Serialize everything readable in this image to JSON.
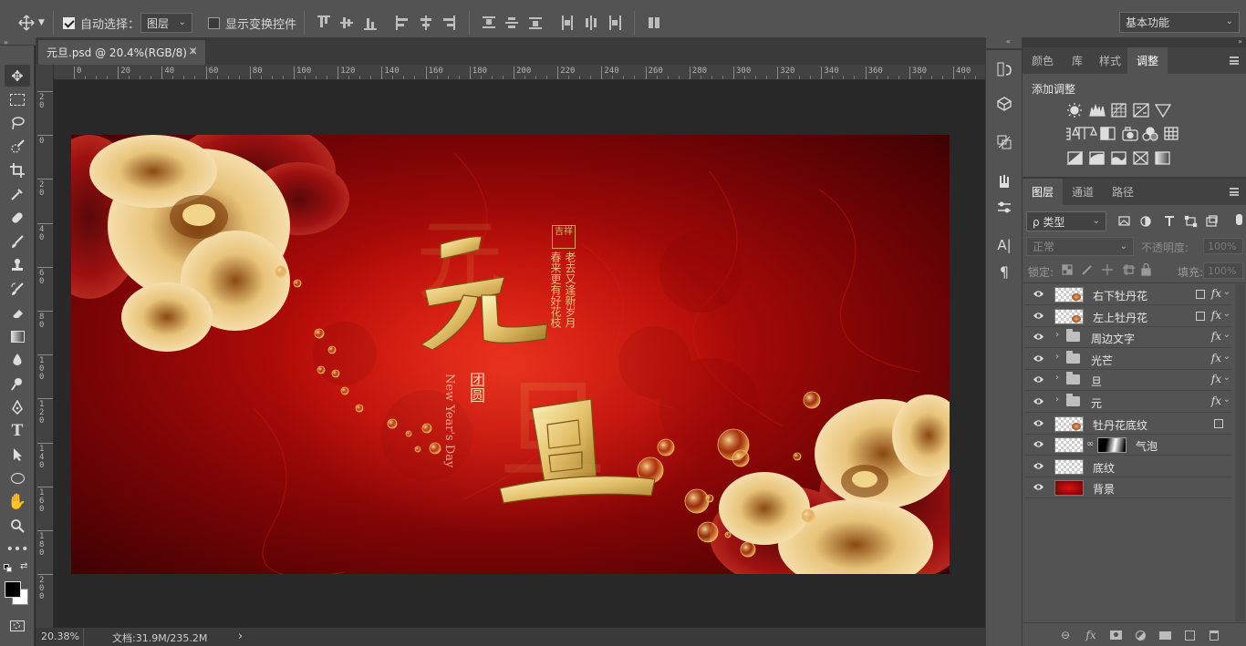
{
  "options_bar": {
    "auto_select_label": "自动选择：",
    "auto_select_checked": true,
    "auto_select_target": "图层",
    "show_transform_label": "显示变换控件",
    "show_transform_checked": false,
    "workspace": "基本功能"
  },
  "document": {
    "tab_title": "元旦.psd @ 20.4%(RGB/8) *",
    "close_glyph": "×",
    "zoom": "20.38%",
    "doc_info": "文档:31.9M/235.2M",
    "status_arrow": "›"
  },
  "rulers": {
    "h_ticks": [
      "0",
      "20",
      "40",
      "60",
      "80",
      "100",
      "120",
      "140",
      "160",
      "180",
      "200",
      "220",
      "240",
      "260",
      "280",
      "300",
      "320",
      "340",
      "360",
      "380",
      "400"
    ],
    "v_ticks": [
      "20",
      "0",
      "20",
      "40",
      "60",
      "80",
      "100",
      "120",
      "140",
      "160",
      "180",
      "200"
    ]
  },
  "artwork": {
    "char_yuan": "元",
    "char_dan": "旦",
    "poem_col1": "老去又逢新岁月",
    "poem_col2": "春来更有好花枝",
    "seal": "吉祥",
    "tuanyuan": "团圆",
    "english": "New Year's Day"
  },
  "panels": {
    "top_tabs": [
      {
        "label": "颜色",
        "active": false
      },
      {
        "label": "库",
        "active": false
      },
      {
        "label": "样式",
        "active": false
      },
      {
        "label": "调整",
        "active": true
      }
    ],
    "adjustments_title": "添加调整",
    "layer_tabs": [
      {
        "label": "图层",
        "active": true
      },
      {
        "label": "通道",
        "active": false
      },
      {
        "label": "路径",
        "active": false
      }
    ],
    "filter_kind": "ρ 类型",
    "blend_mode": "正常",
    "opacity_label": "不透明度:",
    "opacity_value": "100%",
    "lock_label": "锁定:",
    "fill_label": "填充:",
    "fill_value": "100%"
  },
  "layers": [
    {
      "name": "右下牡丹花",
      "kind": "smart",
      "fx": true
    },
    {
      "name": "左上牡丹花",
      "kind": "smart",
      "fx": true
    },
    {
      "name": "周边文字",
      "kind": "group",
      "fx": true
    },
    {
      "name": "光芒",
      "kind": "group",
      "fx": true
    },
    {
      "name": "旦",
      "kind": "group",
      "fx": true
    },
    {
      "name": "元",
      "kind": "group",
      "fx": true
    },
    {
      "name": "牡丹花底纹",
      "kind": "smart",
      "fx": false
    },
    {
      "name": "气泡",
      "kind": "masked",
      "fx": false
    },
    {
      "name": "底纹",
      "kind": "pixel",
      "fx": false
    },
    {
      "name": "背景",
      "kind": "background",
      "fx": false
    }
  ],
  "fx_label": "fx",
  "colors": {
    "ui_dark": "#535353",
    "canvas_red": "#c8140c",
    "gold": "#e8c878"
  }
}
